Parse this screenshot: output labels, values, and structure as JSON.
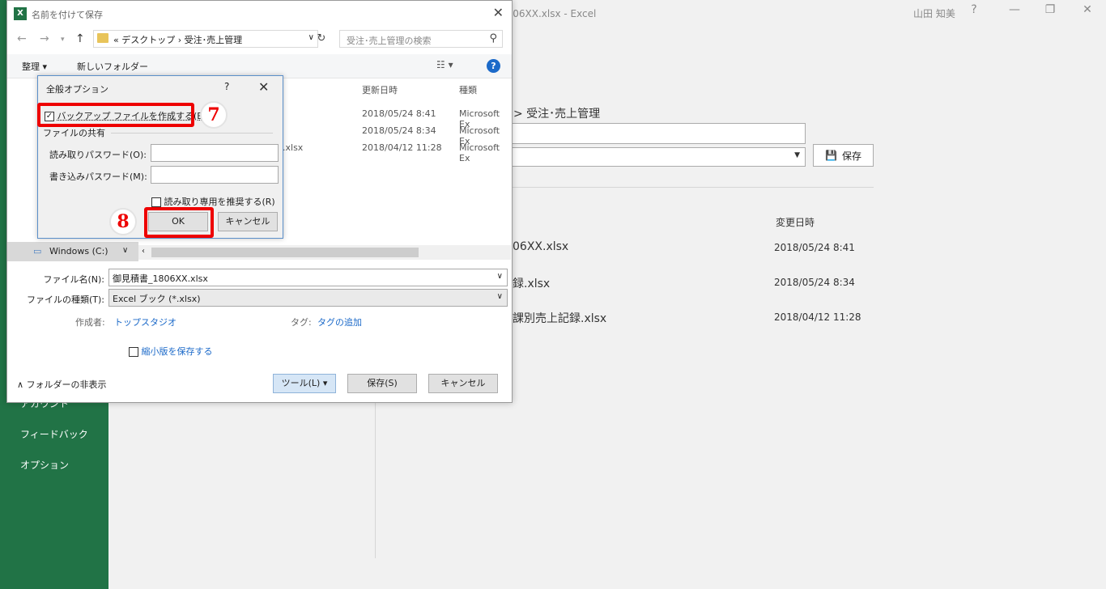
{
  "backstage": {
    "window_title": "書_1806XX.xlsx  -  Excel",
    "user": "山田 知美",
    "help": "?",
    "nav": {
      "account": "アカウント",
      "feedback": "フィードバック",
      "options": "オプション"
    },
    "path": "> 受注･売上管理",
    "save_label": "保存",
    "col_modified": "変更日時",
    "files": [
      {
        "name": "06XX.xlsx",
        "date": "2018/05/24 8:41"
      },
      {
        "name": "録.xlsx",
        "date": "2018/05/24 8:34"
      },
      {
        "name": "課別売上記録.xlsx",
        "date": "2018/04/12 11:28"
      }
    ]
  },
  "save_dialog": {
    "title": "名前を付けて保存",
    "address": "«  デスクトップ  ›  受注･売上管理",
    "search_placeholder": "受注･売上管理の検索",
    "organize": "整理 ▾",
    "new_folder": "新しいフォルダー",
    "col_date": "更新日時",
    "col_type": "種類",
    "rows": [
      {
        "date": "2018/05/24 8:41",
        "type": "Microsoft Ex"
      },
      {
        "date": "2018/05/24 8:34",
        "type": "Microsoft Ex"
      },
      {
        "name_tail": ".xlsx",
        "date": "2018/04/12 11:28",
        "type": "Microsoft Ex"
      }
    ],
    "drive": "Windows (C:)",
    "filename_label": "ファイル名(N):",
    "filename": "御見積書_1806XX.xlsx",
    "filetype_label": "ファイルの種類(T):",
    "filetype": "Excel ブック (*.xlsx)",
    "author_label": "作成者:",
    "author": "トップスタジオ",
    "tags_label": "タグ:",
    "tags": "タグの追加",
    "thumbnail": "縮小版を保存する",
    "hide_folders": "フォルダーの非表示",
    "tools": "ツール(L)",
    "save": "保存(S)",
    "cancel": "キャンセル"
  },
  "options_dialog": {
    "title": "全般オプション",
    "help": "?",
    "backup_label": "バックアップ ファイルを作成する(B)",
    "backup_checked": true,
    "file_sharing": "ファイルの共有",
    "read_password_label": "読み取りパスワード(O):",
    "write_password_label": "書き込みパスワード(M):",
    "read_only_label": "読み取り専用を推奨する(R)",
    "ok": "OK",
    "cancel": "キャンセル"
  },
  "annotations": {
    "step7": "7",
    "step8": "8"
  },
  "colors": {
    "excel_green": "#217346",
    "highlight_red": "#ee0000",
    "link_blue": "#1c6ac9"
  }
}
